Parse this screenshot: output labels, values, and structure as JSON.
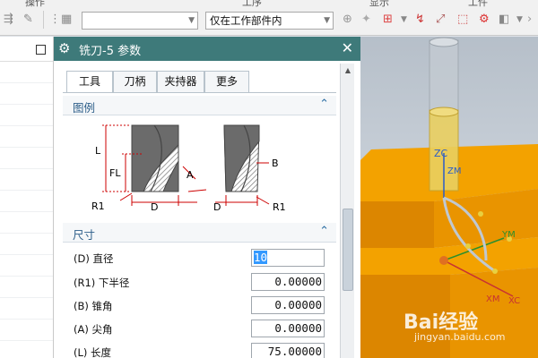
{
  "toolbar": {
    "group_labels": [
      "操作",
      "工序",
      "显示",
      "工件"
    ],
    "filter_value": "",
    "scope_value": "仅在工作部件内"
  },
  "dialog": {
    "title": "铣刀-5 参数",
    "tabs": [
      {
        "label": "工具"
      },
      {
        "label": "刀柄"
      },
      {
        "label": "夹持器"
      },
      {
        "label": "更多"
      }
    ],
    "legend_section": "图例",
    "size_section": "尺寸",
    "diagram_labels": {
      "L": "L",
      "FL": "FL",
      "A": "A",
      "R1_left": "R1",
      "D_left": "D",
      "B": "B",
      "D_right": "D",
      "R1_right": "R1"
    },
    "fields": [
      {
        "label": "(D) 直径",
        "value": "10"
      },
      {
        "label": "(R1) 下半径",
        "value": "0.00000"
      },
      {
        "label": "(B) 锥角",
        "value": "0.00000"
      },
      {
        "label": "(A) 尖角",
        "value": "0.00000"
      },
      {
        "label": "(L) 长度",
        "value": "75.00000"
      }
    ]
  },
  "viewport": {
    "axis_labels": {
      "zc": "ZC",
      "zm": "ZM",
      "ym": "YM",
      "xm": "XM",
      "xc": "XC"
    },
    "colors": {
      "block": "#f2a300",
      "tool": "#e8c040",
      "background": "#c7cfd8",
      "title_bar": "#3e7a7a"
    }
  },
  "watermark": {
    "logo": "Bai经验",
    "sub": "jingyan.baidu.com"
  }
}
